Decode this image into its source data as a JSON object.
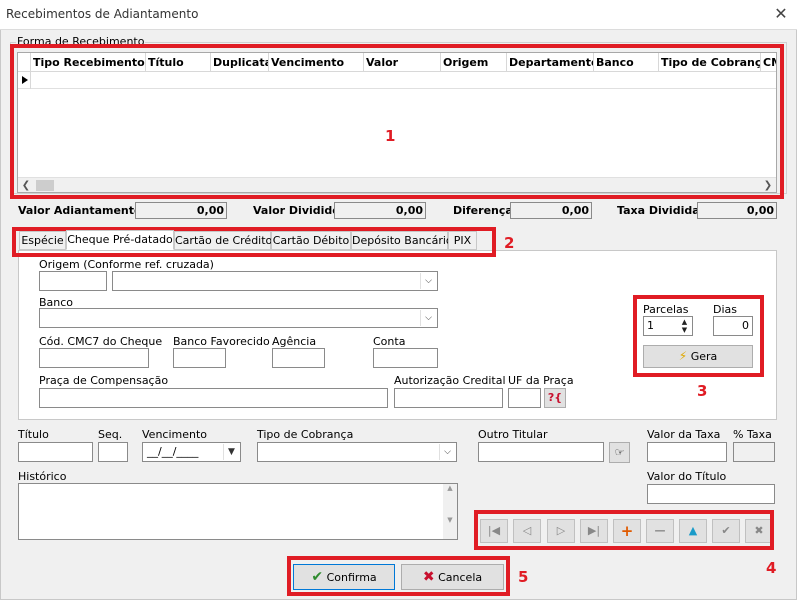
{
  "window": {
    "title": "Recebimentos de Adiantamento",
    "close": "✕"
  },
  "group": {
    "label": "Forma de Recebimento"
  },
  "grid": {
    "columns": [
      "Tipo Recebimento",
      "Título",
      "Duplicata",
      "Vencimento",
      "Valor",
      "Origem",
      "Departamento",
      "Banco",
      "Tipo de Cobrança",
      "CM"
    ]
  },
  "annotations": {
    "n1": "1",
    "n2": "2",
    "n3": "3",
    "n4": "4",
    "n5": "5"
  },
  "totals": {
    "adiantamento_label": "Valor Adiantamento",
    "adiantamento_value": "0,00",
    "dividido_label": "Valor Dividido",
    "dividido_value": "0,00",
    "diferenca_label": "Diferença",
    "diferenca_value": "0,00",
    "taxa_label": "Taxa Dividida",
    "taxa_value": "0,00"
  },
  "tabs": [
    "Espécie",
    "Cheque Pré-datado",
    "Cartão de Crédito",
    "Cartão Débito",
    "Depósito Bancário",
    "PIX"
  ],
  "cheque": {
    "origem_label": "Origem (Conforme ref. cruzada)",
    "banco_label": "Banco",
    "cmc7_label": "Cód. CMC7 do Cheque",
    "banco_fav_label": "Banco Favorecido",
    "agencia_label": "Agência",
    "conta_label": "Conta",
    "praca_label": "Praça de Compensação",
    "autorizacao_label": "Autorização Credital",
    "uf_label": "UF da Praça",
    "parcelas_label": "Parcelas",
    "parcelas_value": "1",
    "dias_label": "Dias",
    "dias_value": "0",
    "gera_label": "Gera"
  },
  "bottom": {
    "titulo_label": "Título",
    "seq_label": "Seq.",
    "vencimento_label": "Vencimento",
    "vencimento_value": "__/__/____",
    "tipo_cobranca_label": "Tipo de Cobrança",
    "outro_titular_label": "Outro Titular",
    "valor_taxa_label": "Valor da Taxa",
    "pct_taxa_label": "% Taxa",
    "historico_label": "Histórico",
    "valor_titulo_label": "Valor do Título"
  },
  "buttons": {
    "confirma": "Confirma",
    "cancela": "Cancela"
  },
  "colors": {
    "annotation": "#e01c24",
    "confirm_check": "#2e8b2e",
    "cancel_x": "#c8102e"
  }
}
